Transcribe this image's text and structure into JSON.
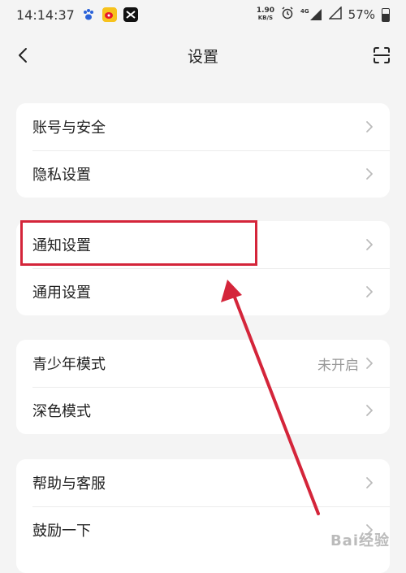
{
  "status_bar": {
    "time": "14:14:37",
    "net_speed_value": "1.90",
    "net_speed_unit": "KB/S",
    "network_type": "4G",
    "battery": "57%",
    "battery_level": 0.57
  },
  "nav": {
    "title": "设置"
  },
  "groups": [
    {
      "items": [
        {
          "label": "账号与安全"
        },
        {
          "label": "隐私设置"
        }
      ]
    },
    {
      "items": [
        {
          "label": "通知设置"
        },
        {
          "label": "通用设置"
        }
      ]
    },
    {
      "items": [
        {
          "label": "青少年模式",
          "value": "未开启"
        },
        {
          "label": "深色模式"
        }
      ]
    },
    {
      "items": [
        {
          "label": "帮助与客服"
        },
        {
          "label": "鼓励一下"
        }
      ]
    }
  ],
  "watermark": "Bai经验",
  "colors": {
    "annotation": "#d4253a",
    "background": "#f4f4f4",
    "card": "#ffffff"
  }
}
